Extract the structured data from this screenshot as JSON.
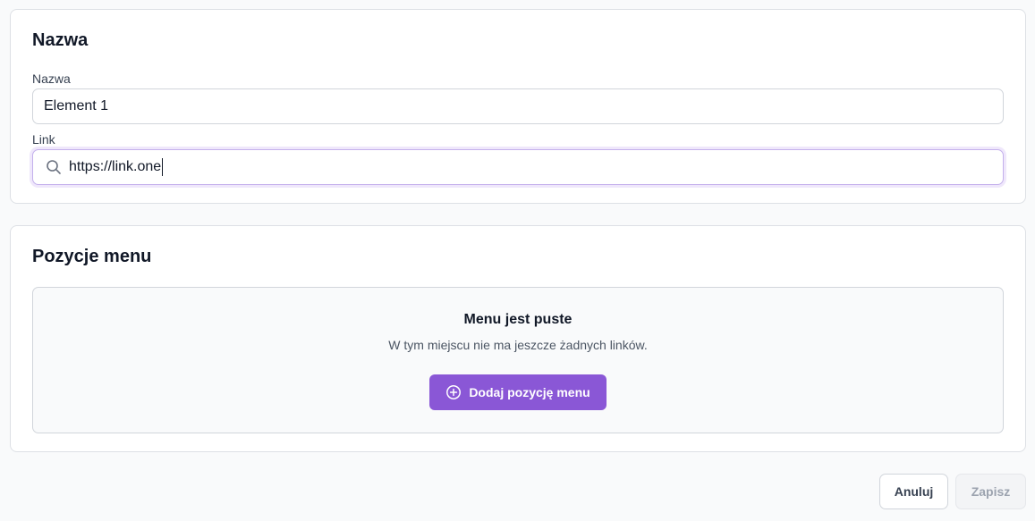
{
  "name_section": {
    "title": "Nazwa",
    "name_label": "Nazwa",
    "name_value": "Element 1",
    "link_label": "Link",
    "link_value": "https://link.one"
  },
  "menu_section": {
    "title": "Pozycje menu",
    "empty_title": "Menu jest puste",
    "empty_description": "W tym miejscu nie ma jeszcze żadnych linków.",
    "add_button_label": "Dodaj pozycję menu"
  },
  "footer": {
    "cancel_label": "Anuluj",
    "save_label": "Zapisz"
  },
  "colors": {
    "accent": "#8a57d6",
    "focus_ring": "#efe7fb"
  },
  "icons": {
    "link_field": "search-icon",
    "add_button": "plus-circle-icon"
  }
}
